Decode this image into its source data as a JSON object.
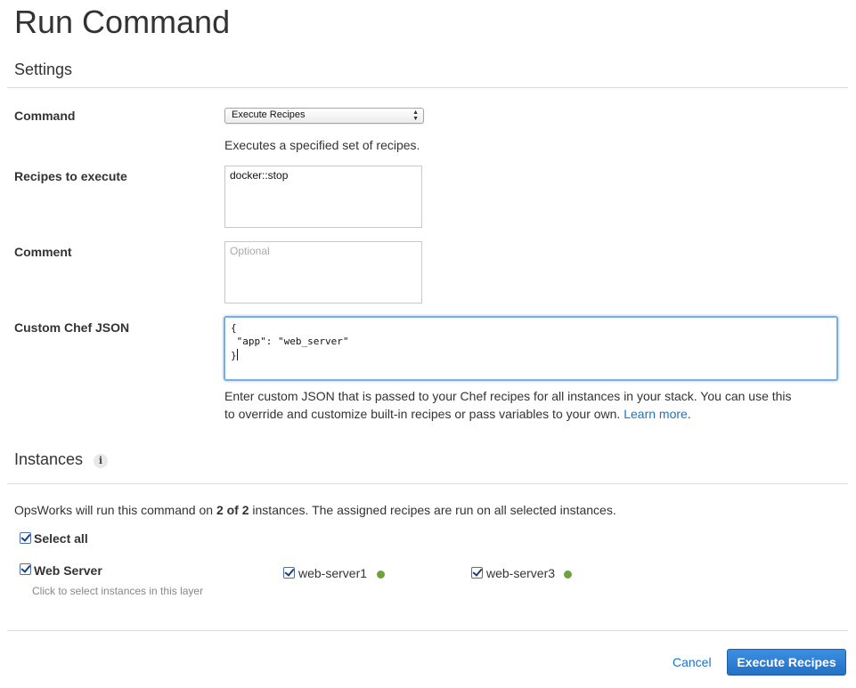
{
  "page": {
    "title": "Run Command"
  },
  "settings": {
    "section_title": "Settings",
    "command": {
      "label": "Command",
      "selected": "Execute Recipes",
      "description": "Executes a specified set of recipes."
    },
    "recipes": {
      "label": "Recipes to execute",
      "value": "docker::stop"
    },
    "comment": {
      "label": "Comment",
      "value": "",
      "placeholder": "Optional"
    },
    "custom_json": {
      "label": "Custom Chef JSON",
      "lines": [
        "{",
        " \"app\": \"web_server\"",
        "}"
      ],
      "help_text_1": "Enter custom JSON that is passed to your Chef recipes for all instances in your stack. You can use this",
      "help_text_2": "to override and customize built-in recipes or pass variables to your own.",
      "learn_more": "Learn more",
      "period": "."
    }
  },
  "instances": {
    "section_title": "Instances",
    "info_icon": "i",
    "summary_prefix": "OpsWorks will run this command on ",
    "summary_count": "2 of 2",
    "summary_suffix": " instances. The assigned recipes are run on all selected instances.",
    "select_all": {
      "label": "Select all",
      "checked": true
    },
    "layer": {
      "name": "Web Server",
      "checked": true,
      "hint": "Click to select instances in this layer"
    },
    "items": [
      {
        "name": "web-server1",
        "checked": true,
        "status_color": "#6ea23c"
      },
      {
        "name": "web-server3",
        "checked": true,
        "status_color": "#6ea23c"
      }
    ]
  },
  "footer": {
    "cancel": "Cancel",
    "submit": "Execute Recipes"
  },
  "colors": {
    "accent": "#2470c8",
    "link": "#1a73c9",
    "online": "#6ea23c",
    "focus": "#7aaedf"
  }
}
